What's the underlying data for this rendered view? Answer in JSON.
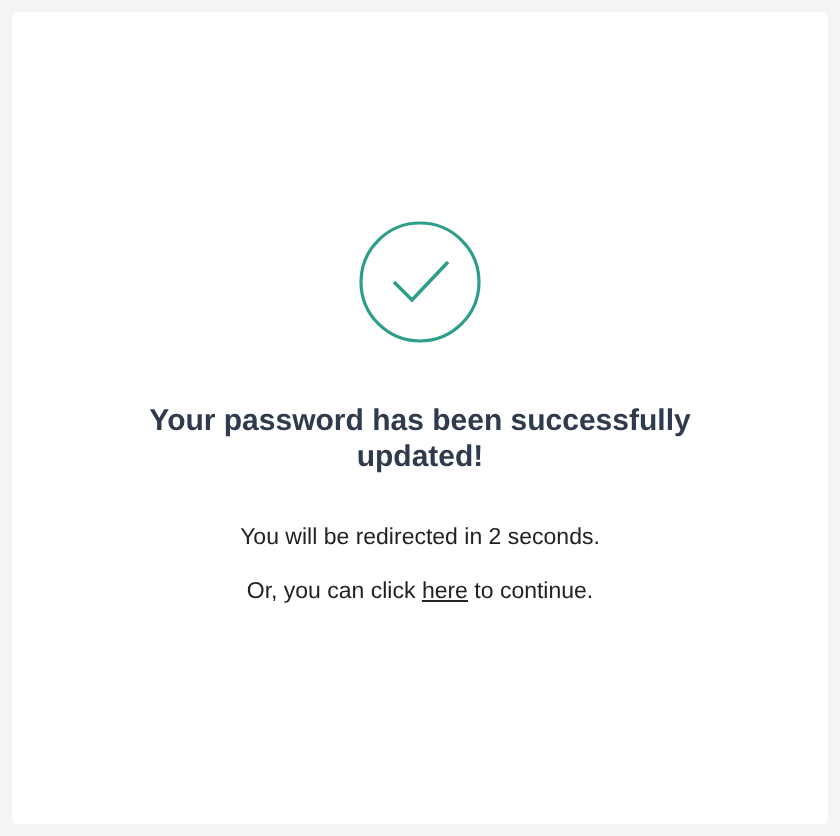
{
  "heading": "Your password has been successfully updated!",
  "redirect_message": "You will be redirected in 2 seconds.",
  "continue_message": {
    "before": "Or, you can click ",
    "link": "here",
    "after": " to continue."
  }
}
